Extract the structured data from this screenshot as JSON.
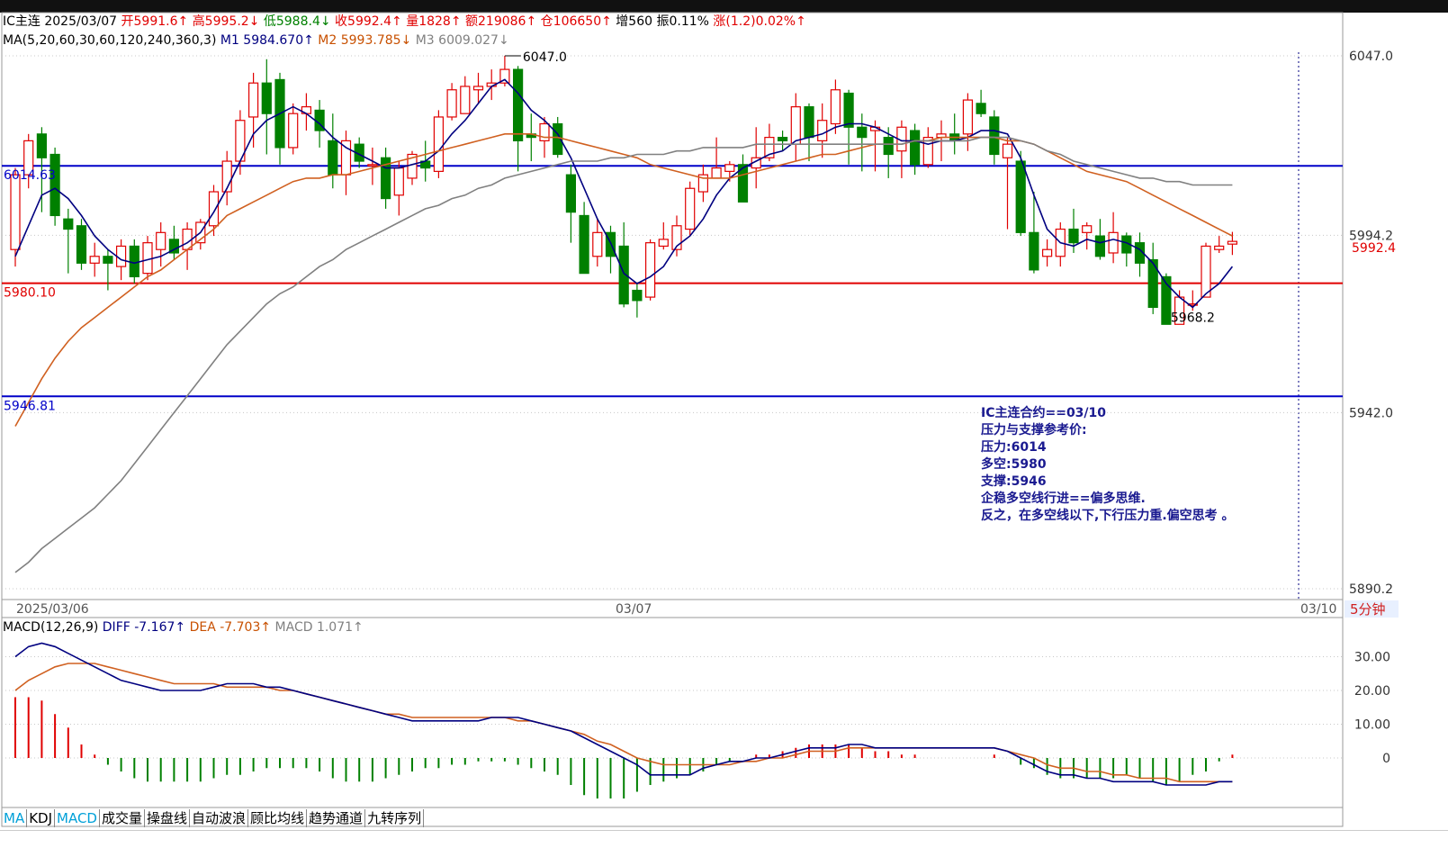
{
  "header": {
    "symbol": "IC主连",
    "date": "2025/03/07",
    "open": "开5991.6↑",
    "high": "高5995.2↓",
    "low": "低5988.4↓",
    "close": "收5992.4↑",
    "volume": "量1828↑",
    "amount": "额219086↑",
    "position": "仓106650↑",
    "increase": "增560",
    "amplitude": "振0.11%",
    "change": "涨(1.2)0.02%↑"
  },
  "ma_info": {
    "label": "MA(5,20,60,30,60,120,240,360,3)",
    "m1": "M1 5984.670↑",
    "m2": "M2 5993.785↓",
    "m3": "M3 6009.027↓"
  },
  "macd_info": {
    "label": "MACD(12,26,9)",
    "diff": "DIFF -7.167↑",
    "dea": "DEA -7.703↑",
    "macd": "MACD 1.071↑"
  },
  "levels": {
    "resistance": "6014.63",
    "bull_bear": "5980.10",
    "support": "5946.81"
  },
  "annotations": {
    "high_label": "6047.0",
    "low_label": "5968.2",
    "last_price": "5992.4"
  },
  "note": [
    "IC主连合约==03/10",
    "压力与支撑参考价:",
    "压力:6014",
    "多空:5980",
    "支撑:5946",
    "企稳多空线行进==偏多思维.",
    "反之，在多空线以下,下行压力重.偏空思考 。"
  ],
  "price_axis": [
    "6047.0",
    "5994.2",
    "5942.0",
    "5890.2"
  ],
  "macd_axis": [
    "30.00",
    "20.00",
    "10.00",
    "0"
  ],
  "time_axis": [
    "2025/03/06",
    "03/07",
    "03/10"
  ],
  "period": "5分钟",
  "tabs": [
    "MA",
    "KDJ",
    "MACD",
    "成交量",
    "操盘线",
    "自动波浪",
    "顾比均线",
    "趋势通道",
    "九转序列"
  ],
  "colors": {
    "up": "#e00000",
    "down": "#008000",
    "m1": "#000080",
    "m2": "#d06020",
    "m3": "#808080",
    "resistance_line": "#0000c8",
    "bull_bear_line": "#e00000"
  },
  "chart_data": {
    "type": "candlestick",
    "title": "IC主连 5分钟",
    "yrange": [
      5890.2,
      6047.0
    ],
    "candles": [
      [
        5990,
        6012,
        6014,
        5985
      ],
      [
        6012,
        6022,
        6024,
        6008
      ],
      [
        6024,
        6017,
        6026,
        6001
      ],
      [
        6018,
        6000,
        6020,
        5997
      ],
      [
        5999,
        5996,
        6002,
        5983
      ],
      [
        5997,
        5986,
        5999,
        5984
      ],
      [
        5986,
        5988,
        5992,
        5982
      ],
      [
        5988,
        5986,
        5990,
        5978
      ],
      [
        5985,
        5991,
        5993,
        5981
      ],
      [
        5991,
        5982,
        5993,
        5980
      ],
      [
        5983,
        5992,
        5994,
        5981
      ],
      [
        5990,
        5995,
        5998,
        5985
      ],
      [
        5993,
        5989,
        5997,
        5987
      ],
      [
        5990,
        5996,
        5998,
        5984
      ],
      [
        5992,
        5998,
        5999,
        5990
      ],
      [
        5997,
        6007,
        6009,
        5994
      ],
      [
        6007,
        6016,
        6019,
        6003
      ],
      [
        6016,
        6028,
        6031,
        6012
      ],
      [
        6029,
        6039,
        6042,
        6020
      ],
      [
        6039,
        6030,
        6046,
        6018
      ],
      [
        6040,
        6020,
        6042,
        6015
      ],
      [
        6020,
        6030,
        6033,
        6018
      ],
      [
        6030,
        6032,
        6036,
        6025
      ],
      [
        6031,
        6025,
        6034,
        6020
      ],
      [
        6022,
        6012,
        6030,
        6008
      ],
      [
        6012,
        6022,
        6025,
        6006
      ],
      [
        6021,
        6016,
        6023,
        6014
      ],
      [
        6015,
        6015,
        6020,
        6009
      ],
      [
        6017,
        6005,
        6020,
        6002
      ],
      [
        6006,
        6014,
        6016,
        6000
      ],
      [
        6011,
        6018,
        6019,
        6009
      ],
      [
        6016,
        6014,
        6022,
        6010
      ],
      [
        6013,
        6029,
        6031,
        6011
      ],
      [
        6029,
        6037,
        6039,
        6028
      ],
      [
        6030,
        6038,
        6041,
        6030
      ],
      [
        6037,
        6038,
        6042,
        6033
      ],
      [
        6038,
        6039,
        6043,
        6034
      ],
      [
        6039,
        6043,
        6047,
        6038
      ],
      [
        6043,
        6022,
        6044,
        6013
      ],
      [
        6024,
        6023,
        6030,
        6016
      ],
      [
        6022,
        6027,
        6029,
        6017
      ],
      [
        6027,
        6018,
        6029,
        6017
      ],
      [
        6012,
        6001,
        6015,
        5992
      ],
      [
        6000,
        5983,
        6004,
        5986
      ],
      [
        5988,
        5995,
        5999,
        5985
      ],
      [
        5995,
        5988,
        5997,
        5983
      ],
      [
        5991,
        5974,
        5998,
        5973
      ],
      [
        5978,
        5975,
        5980,
        5970
      ],
      [
        5976,
        5992,
        5993,
        5975
      ],
      [
        5991,
        5993,
        5998,
        5990
      ],
      [
        5990,
        5997,
        6000,
        5988
      ],
      [
        5996,
        6008,
        6010,
        5994
      ],
      [
        6007,
        6012,
        6015,
        6004
      ],
      [
        6011,
        6014,
        6023,
        6011
      ],
      [
        6013,
        6015,
        6016,
        6010
      ],
      [
        6015,
        6004,
        6018,
        6007
      ],
      [
        6014,
        6017,
        6026,
        6008
      ],
      [
        6017,
        6023,
        6027,
        6016
      ],
      [
        6023,
        6022,
        6025,
        6019
      ],
      [
        6021,
        6032,
        6036,
        6016
      ],
      [
        6032,
        6023,
        6033,
        6016
      ],
      [
        6022,
        6028,
        6033,
        6017
      ],
      [
        6027,
        6037,
        6040,
        6024
      ],
      [
        6036,
        6026,
        6037,
        6015
      ],
      [
        6026,
        6023,
        6030,
        6013
      ],
      [
        6025,
        6026,
        6028,
        6013
      ],
      [
        6023,
        6018,
        6026,
        6011
      ],
      [
        6019,
        6026,
        6028,
        6011
      ],
      [
        6025,
        6015,
        6027,
        6012
      ],
      [
        6015,
        6023,
        6026,
        6014
      ],
      [
        6023,
        6024,
        6028,
        6016
      ],
      [
        6024,
        6022,
        6030,
        6018
      ],
      [
        6024,
        6034,
        6036,
        6019
      ],
      [
        6033,
        6030,
        6037,
        6029
      ],
      [
        6029,
        6018,
        6031,
        6015
      ],
      [
        6017,
        6021,
        6023,
        5996
      ],
      [
        6016,
        5995,
        6019,
        5994
      ],
      [
        5995,
        5984,
        6007,
        5983
      ],
      [
        5988,
        5990,
        5993,
        5985
      ],
      [
        5988,
        5996,
        5998,
        5985
      ],
      [
        5996,
        5992,
        6002,
        5989
      ],
      [
        5995,
        5997,
        5998,
        5990
      ],
      [
        5994,
        5988,
        5999,
        5987
      ],
      [
        5989,
        5995,
        6001,
        5986
      ],
      [
        5994,
        5989,
        5995,
        5985
      ],
      [
        5992,
        5986,
        5995,
        5982
      ],
      [
        5987,
        5973,
        5992,
        5971
      ],
      [
        5982,
        5968,
        5983,
        5968
      ],
      [
        5968,
        5976,
        5978,
        5968
      ],
      [
        5974,
        5974,
        5978,
        5972
      ],
      [
        5976,
        5991,
        5992,
        5976
      ],
      [
        5990,
        5991,
        5994,
        5989
      ],
      [
        5991.6,
        5992.4,
        5995.2,
        5988.4
      ]
    ],
    "series": [
      {
        "name": "M1",
        "values": [
          5988,
          5997,
          6006,
          6008,
          6005,
          6000,
          5994,
          5990,
          5987,
          5986,
          5987,
          5988,
          5990,
          5992,
          5995,
          6001,
          6008,
          6016,
          6024,
          6028,
          6030,
          6032,
          6030,
          6027,
          6023,
          6020,
          6018,
          6016,
          6014,
          6014,
          6015,
          6016,
          6019,
          6024,
          6028,
          6033,
          6038,
          6040,
          6036,
          6031,
          6028,
          6024,
          6017,
          6008,
          5999,
          5992,
          5983,
          5980,
          5982,
          5985,
          5991,
          5994,
          5999,
          6006,
          6011,
          6014,
          6016,
          6018,
          6019,
          6022,
          6023,
          6024,
          6026,
          6027,
          6027,
          6026,
          6024,
          6022,
          6022,
          6021,
          6022,
          6022,
          6023,
          6025,
          6025,
          6024,
          6017,
          6006,
          5996,
          5992,
          5991,
          5993,
          5992,
          5993,
          5992,
          5990,
          5986,
          5980,
          5976,
          5973,
          5977,
          5980,
          5985
        ]
      },
      {
        "name": "M2",
        "values": [
          5938,
          5945,
          5952,
          5958,
          5963,
          5967,
          5970,
          5973,
          5976,
          5979,
          5982,
          5984,
          5987,
          5990,
          5993,
          5996,
          6000,
          6002,
          6004,
          6006,
          6008,
          6010,
          6011,
          6011,
          6012,
          6012,
          6013,
          6014,
          6015,
          6016,
          6017,
          6018,
          6019,
          6020,
          6021,
          6022,
          6023,
          6024,
          6024,
          6024,
          6023,
          6023,
          6022,
          6021,
          6020,
          6019,
          6018,
          6017,
          6015,
          6014,
          6013,
          6012,
          6011,
          6011,
          6011,
          6012,
          6013,
          6014,
          6015,
          6016,
          6017,
          6018,
          6018,
          6019,
          6020,
          6021,
          6021,
          6021,
          6022,
          6022,
          6023,
          6023,
          6023,
          6023,
          6023,
          6022,
          6022,
          6021,
          6019,
          6017,
          6015,
          6013,
          6012,
          6011,
          6010,
          6008,
          6006,
          6004,
          6002,
          6000,
          5998,
          5996,
          5994
        ]
      },
      {
        "name": "M3",
        "values": [
          5895,
          5898,
          5902,
          5905,
          5908,
          5911,
          5914,
          5918,
          5922,
          5927,
          5932,
          5937,
          5942,
          5947,
          5952,
          5957,
          5962,
          5966,
          5970,
          5974,
          5977,
          5979,
          5982,
          5985,
          5987,
          5990,
          5992,
          5994,
          5996,
          5998,
          6000,
          6002,
          6003,
          6005,
          6006,
          6008,
          6009,
          6011,
          6012,
          6013,
          6014,
          6015,
          6016,
          6016,
          6016,
          6017,
          6017,
          6018,
          6018,
          6018,
          6019,
          6019,
          6020,
          6020,
          6020,
          6020,
          6021,
          6021,
          6021,
          6021,
          6021,
          6021,
          6021,
          6021,
          6021,
          6021,
          6021,
          6021,
          6022,
          6022,
          6022,
          6022,
          6022,
          6023,
          6023,
          6023,
          6022,
          6021,
          6019,
          6018,
          6016,
          6015,
          6014,
          6013,
          6012,
          6011,
          6011,
          6010,
          6010,
          6009,
          6009,
          6009,
          6009
        ]
      }
    ],
    "levels": [
      6014.63,
      5980.1,
      5946.81
    ],
    "macd": {
      "diff": [
        30,
        33,
        34,
        33,
        31,
        29,
        27,
        25,
        23,
        22,
        21,
        20,
        20,
        20,
        20,
        21,
        22,
        22,
        22,
        21,
        21,
        20,
        19,
        18,
        17,
        16,
        15,
        14,
        13,
        12,
        11,
        11,
        11,
        11,
        11,
        11,
        12,
        12,
        12,
        11,
        10,
        9,
        8,
        6,
        4,
        2,
        0,
        -2,
        -5,
        -5,
        -5,
        -5,
        -3,
        -2,
        -1,
        -1,
        0,
        0,
        1,
        2,
        3,
        3,
        3,
        4,
        4,
        3,
        3,
        3,
        3,
        3,
        3,
        3,
        3,
        3,
        3,
        2,
        0,
        -2,
        -4,
        -5,
        -5,
        -6,
        -6,
        -7,
        -7,
        -7,
        -7,
        -8,
        -8,
        -8,
        -8,
        -7,
        -7
      ],
      "dea": [
        20,
        23,
        25,
        27,
        28,
        28,
        28,
        27,
        26,
        25,
        24,
        23,
        22,
        22,
        22,
        22,
        21,
        21,
        21,
        21,
        20,
        20,
        19,
        18,
        17,
        16,
        15,
        14,
        13,
        13,
        12,
        12,
        12,
        12,
        12,
        12,
        12,
        12,
        11,
        11,
        10,
        9,
        8,
        7,
        5,
        4,
        2,
        0,
        -1,
        -2,
        -2,
        -2,
        -2,
        -2,
        -2,
        -1,
        -1,
        0,
        0,
        1,
        2,
        2,
        2,
        3,
        3,
        3,
        3,
        3,
        3,
        3,
        3,
        3,
        3,
        3,
        3,
        2,
        1,
        0,
        -2,
        -3,
        -3,
        -4,
        -4,
        -5,
        -5,
        -6,
        -6,
        -6,
        -7,
        -7,
        -7,
        -7,
        -7
      ],
      "hist": [
        18,
        18,
        17,
        13,
        9,
        4,
        1,
        -2,
        -4,
        -6,
        -7,
        -7,
        -7,
        -7,
        -7,
        -6,
        -5,
        -5,
        -4,
        -3,
        -3,
        -3,
        -3,
        -4,
        -6,
        -7,
        -7,
        -7,
        -6,
        -5,
        -4,
        -3,
        -3,
        -2,
        -2,
        -1,
        -1,
        -1,
        -2,
        -3,
        -4,
        -5,
        -8,
        -11,
        -12,
        -12,
        -12,
        -10,
        -8,
        -7,
        -6,
        -5,
        -4,
        -2,
        -1,
        0,
        1,
        1,
        2,
        3,
        4,
        4,
        4,
        4,
        3,
        2,
        2,
        1,
        1,
        0,
        0,
        0,
        0,
        0,
        1,
        0,
        -2,
        -3,
        -5,
        -6,
        -6,
        -6,
        -6,
        -6,
        -5,
        -6,
        -7,
        -8,
        -7,
        -5,
        -4,
        -1,
        1
      ]
    }
  }
}
